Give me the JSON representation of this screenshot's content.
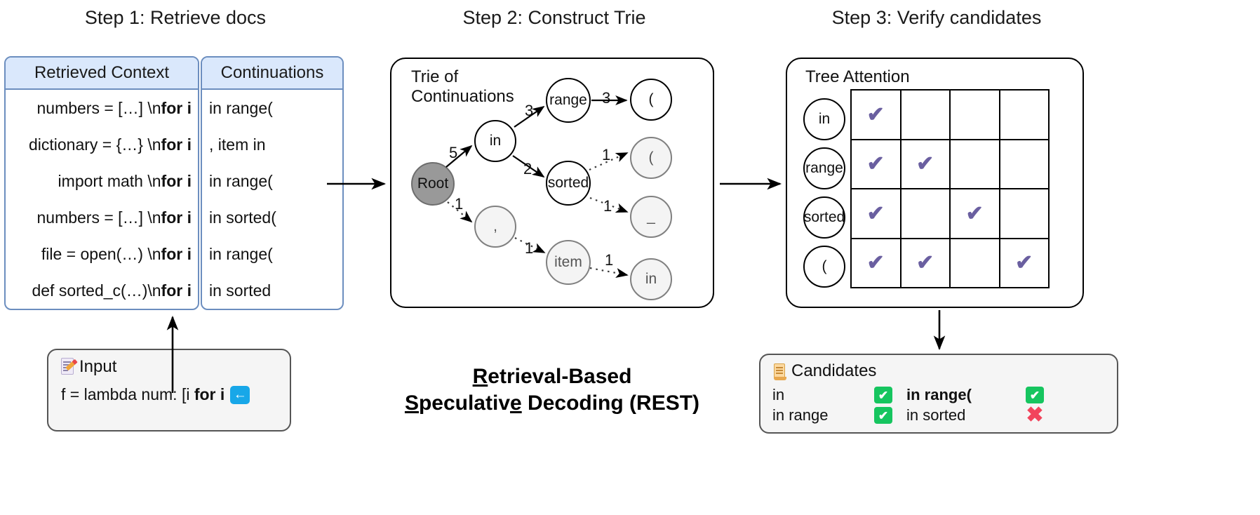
{
  "steps": [
    {
      "label": "Step 1: Retrieve docs"
    },
    {
      "label": "Step 2: Construct Trie"
    },
    {
      "label": "Step 3: Verify candidates"
    }
  ],
  "step1": {
    "columns": [
      "Retrieved Context",
      "Continuations"
    ],
    "rows": [
      {
        "context_prefix": "numbers = […] \\n ",
        "context_bold": "for i",
        "continuation": "in range("
      },
      {
        "context_prefix": "dictionary = {…} \\n ",
        "context_bold": "for i",
        "continuation": ", item in"
      },
      {
        "context_prefix": "import math \\n ",
        "context_bold": "for i",
        "continuation": "in range("
      },
      {
        "context_prefix": "numbers = […] \\n ",
        "context_bold": "for i",
        "continuation": "in sorted("
      },
      {
        "context_prefix": "file = open(…) \\n ",
        "context_bold": "for i",
        "continuation": "in range("
      },
      {
        "context_prefix": "def sorted_c(…)\\n ",
        "context_bold": "for i",
        "continuation": "in sorted"
      }
    ]
  },
  "input_box": {
    "icon": "memo-icon",
    "title": "Input",
    "text_prefix": "f = lambda num: [i ",
    "text_bold": "for i",
    "badge": "←"
  },
  "step2": {
    "panel_label": "Trie of\nContinuations",
    "nodes": [
      {
        "id": "root",
        "label": "Root",
        "style": "root"
      },
      {
        "id": "in",
        "label": "in",
        "style": "solid"
      },
      {
        "id": "comma",
        "label": ",",
        "style": "faded"
      },
      {
        "id": "range",
        "label": "range",
        "style": "solid"
      },
      {
        "id": "sorted",
        "label": "sorted",
        "style": "solid"
      },
      {
        "id": "item",
        "label": "item",
        "style": "faded"
      },
      {
        "id": "paren1",
        "label": "(",
        "style": "solid"
      },
      {
        "id": "paren2",
        "label": "(",
        "style": "faded"
      },
      {
        "id": "under",
        "label": "_",
        "style": "faded"
      },
      {
        "id": "in2",
        "label": "in",
        "style": "faded"
      }
    ],
    "edges": [
      {
        "from": "root",
        "to": "in",
        "count": "5",
        "style": "solid"
      },
      {
        "from": "root",
        "to": "comma",
        "count": "1",
        "style": "dotted"
      },
      {
        "from": "in",
        "to": "range",
        "count": "3",
        "style": "solid"
      },
      {
        "from": "in",
        "to": "sorted",
        "count": "2",
        "style": "solid"
      },
      {
        "from": "range",
        "to": "paren1",
        "count": "3",
        "style": "solid"
      },
      {
        "from": "sorted",
        "to": "paren2",
        "count": "1",
        "style": "dotted"
      },
      {
        "from": "sorted",
        "to": "under",
        "count": "1",
        "style": "dotted"
      },
      {
        "from": "comma",
        "to": "item",
        "count": "1",
        "style": "dotted"
      },
      {
        "from": "item",
        "to": "in2",
        "count": "1",
        "style": "dotted"
      }
    ]
  },
  "step3": {
    "panel_label": "Tree Attention",
    "row_tokens": [
      "in",
      "range",
      "sorted",
      "("
    ],
    "matrix": [
      [
        1,
        0,
        0,
        0
      ],
      [
        1,
        1,
        0,
        0
      ],
      [
        1,
        0,
        1,
        0
      ],
      [
        1,
        1,
        0,
        1
      ]
    ],
    "check_glyph": "✔",
    "check_color": "#6a5fa0"
  },
  "candidates": {
    "icon": "scroll-icon",
    "title": "Candidates",
    "items": [
      {
        "label": "in",
        "bold": false,
        "status": "ok",
        "col": 0,
        "row": 0
      },
      {
        "label": "in range(",
        "bold": true,
        "status": "ok",
        "col": 1,
        "row": 0
      },
      {
        "label": "in range",
        "bold": false,
        "status": "ok",
        "col": 0,
        "row": 1
      },
      {
        "label": "in sorted",
        "bold": false,
        "status": "fail",
        "col": 1,
        "row": 1
      }
    ],
    "ok_glyph": "✔",
    "fail_glyph": "✖"
  },
  "center_title": {
    "line1_pre": "R",
    "line1_rest": "etrieval-Based",
    "line2_pre": "S",
    "line2_mid": "peculativ",
    "line2_e": "e",
    "line2_rest": " Decoding (REST)"
  },
  "colors": {
    "table_header_bg": "#dae8fc",
    "table_border": "#6c8ebf",
    "check_purple": "#6a5fa0",
    "ok_green": "#16c55f",
    "fail_red": "#f2445c",
    "badge_blue": "#18a7e8",
    "root_gray": "#999999"
  }
}
